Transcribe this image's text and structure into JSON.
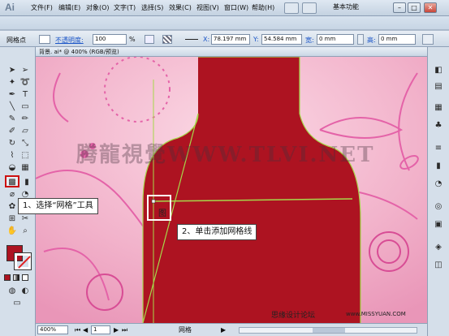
{
  "app": {
    "logo": "Ai"
  },
  "menu": [
    "文件(F)",
    "编辑(E)",
    "对象(O)",
    "文字(T)",
    "选择(S)",
    "效果(C)",
    "视图(V)",
    "窗口(W)",
    "帮助(H)"
  ],
  "workspace": {
    "label": "基本功能"
  },
  "window_controls": {
    "min": "–",
    "max": "□",
    "close": "✕"
  },
  "control_bar": {
    "tool_label": "网格点",
    "opacity_label": "不透明度:",
    "opacity_value": "100",
    "opacity_unit": "%",
    "x_label": "X:",
    "x_value": "78.197 mm",
    "y_label": "Y:",
    "y_value": "54.584 mm",
    "w_label": "宽:",
    "w_value": "0 mm",
    "h_label": "高:",
    "h_value": "0 mm"
  },
  "document": {
    "tab": "背景. ai* @ 400% (RGB/预览)"
  },
  "canvas": {
    "watermark": "腾龍視覺WWW.TLVI.NET",
    "site_watermark": "思缘设计论坛",
    "site_url": "www.MISSYUAN.COM",
    "cursor_glyph": "图",
    "colors": {
      "bottle": "#ad1321",
      "background": "#f2b9d0",
      "mesh_line": "#a6d84a"
    }
  },
  "callouts": {
    "step1": "1、选择“网格”工具",
    "step2": "2、单击添加网格线"
  },
  "statusbar": {
    "zoom": "400%",
    "page": "1",
    "tool_name": "网格"
  },
  "colors": {
    "fill": "#ad1321",
    "highlight_border": "#cc1111"
  }
}
